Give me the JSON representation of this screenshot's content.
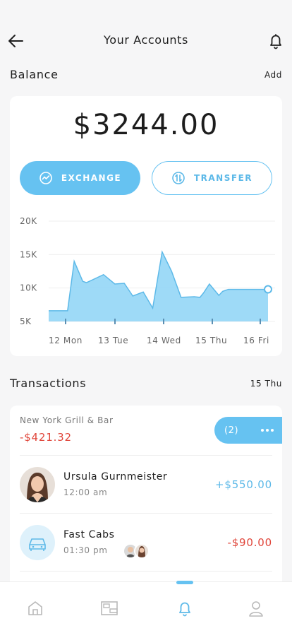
{
  "header": {
    "title": "Your Accounts"
  },
  "balance": {
    "section_title": "Balance",
    "add_label": "Add",
    "amount": "$3244.00",
    "exchange_label": "EXCHANGE",
    "transfer_label": "TRANSFER"
  },
  "chart_data": {
    "type": "area",
    "x_tick_labels": [
      "12 Mon",
      "13 Tue",
      "14 Wed",
      "15 Thu",
      "16 Fri"
    ],
    "y_tick_labels": [
      "20K",
      "15K",
      "10K",
      "5K"
    ],
    "ylim": [
      5000,
      20000
    ],
    "x": [
      0,
      1,
      1.35,
      1.8,
      2,
      2.9,
      3.5,
      4,
      4.45,
      5,
      5.5,
      6,
      6.5,
      7,
      7.7,
      8,
      8.2,
      8.5,
      9,
      9.2,
      9.5,
      10,
      10.25,
      10.5,
      10.8,
      11.15,
      11.5,
      11.6
    ],
    "y": [
      6600,
      6600,
      14000,
      11000,
      10800,
      12000,
      10600,
      10700,
      8800,
      9400,
      7000,
      15400,
      12500,
      8600,
      8700,
      8600,
      9300,
      10600,
      8900,
      9500,
      9800,
      9800,
      9800,
      9800,
      9800,
      9800,
      9800,
      9800
    ],
    "grid": true,
    "fill_color": "#8dd3f6",
    "line_color": "#5db9e8"
  },
  "transactions": {
    "section_title": "Transactions",
    "date_label": "15 Thu",
    "items": [
      {
        "merchant": "New York Grill & Bar",
        "amount": "-$421.32",
        "badge": "(2)"
      },
      {
        "name": "Ursula Gurnmeister",
        "time": "12:00 am",
        "amount": "+$550.00"
      },
      {
        "name": "Fast Cabs",
        "time": "01:30 pm",
        "amount": "-$90.00"
      }
    ]
  },
  "colors": {
    "accent": "#66c2f1",
    "negative": "#e0463b",
    "positive": "#5db9e8"
  },
  "tabs": [
    {
      "icon": "home-icon"
    },
    {
      "icon": "wallet-icon"
    },
    {
      "icon": "bell-icon",
      "active": true
    },
    {
      "icon": "user-icon"
    }
  ]
}
